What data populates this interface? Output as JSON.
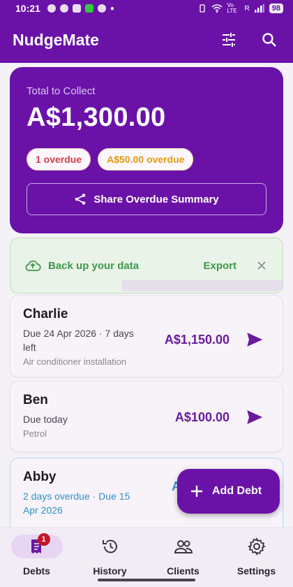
{
  "status_bar": {
    "time": "10:21",
    "network": "Vo LTE",
    "network2": "R",
    "battery": "98"
  },
  "app_bar": {
    "title": "NudgeMate",
    "filter_icon": "tune-icon",
    "search_icon": "search-icon"
  },
  "summary": {
    "label": "Total to Collect",
    "amount": "A$1,300.00",
    "badge_overdue_count": "1 overdue",
    "badge_overdue_amount": "A$50.00 overdue",
    "share_label": "Share Overdue Summary"
  },
  "backup": {
    "text": "Back up your data",
    "export_label": "Export"
  },
  "debts": [
    {
      "name": "Charlie",
      "due": "Due 24 Apr 2026 · 7 days left",
      "note": "Air conditioner installation",
      "amount": "A$1,150.00"
    },
    {
      "name": "Ben",
      "due": "Due today",
      "note": "Petrol",
      "amount": "A$100.00"
    },
    {
      "name": "Abby",
      "due": "2 days overdue · Due 15 Apr 2026",
      "note": "",
      "amount_partial": "A"
    }
  ],
  "fab": {
    "label": "Add Debt"
  },
  "nav": {
    "items": [
      {
        "label": "Debts",
        "badge": "1"
      },
      {
        "label": "History"
      },
      {
        "label": "Clients"
      },
      {
        "label": "Settings"
      }
    ]
  },
  "colors": {
    "primary": "#6a12a8",
    "overdue_red": "#d33b42",
    "overdue_orange": "#e39b0e",
    "backup_green": "#3c9a4c",
    "overdue_blue": "#2f8fc8"
  }
}
